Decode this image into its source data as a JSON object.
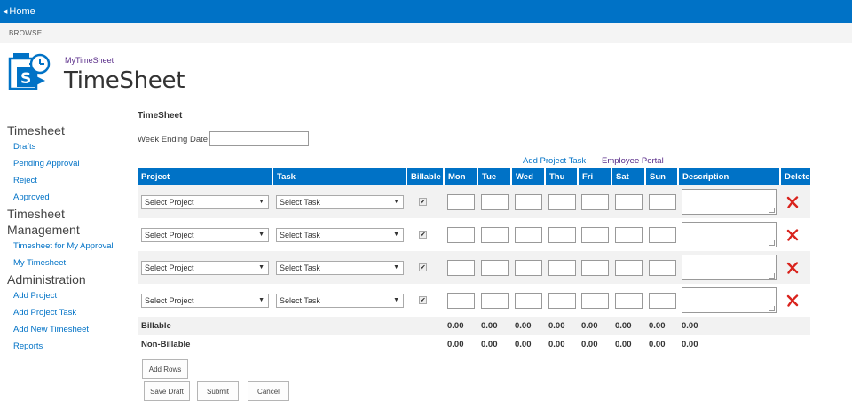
{
  "topbar": {
    "home_label": "Home"
  },
  "browse": {
    "label": "BROWSE"
  },
  "site": {
    "small_title": "MyTimeSheet",
    "title": "TimeSheet"
  },
  "nav": {
    "group1": {
      "heading": "Timesheet",
      "items": [
        "Drafts",
        "Pending Approval",
        "Reject",
        "Approved"
      ]
    },
    "group2": {
      "heading_line1": "Timesheet",
      "heading_line2": "Management",
      "items": [
        "Timesheet for My Approval",
        "My Timesheet"
      ]
    },
    "group3": {
      "heading": "Administration",
      "items": [
        "Add Project",
        "Add Project Task",
        "Add New Timesheet",
        "Reports"
      ]
    }
  },
  "form": {
    "section_title": "TimeSheet",
    "week_label": "Week Ending Date :",
    "week_value": "",
    "add_project_task_link": "Add Project Task",
    "employee_portal_link": "Employee Portal"
  },
  "table": {
    "headers": [
      "Project",
      "Task",
      "Billable",
      "Mon",
      "Tue",
      "Wed",
      "Thu",
      "Fri",
      "Sat",
      "Sun",
      "Description",
      "Delete"
    ],
    "rows": [
      {
        "project": "Select Project",
        "task": "Select Task",
        "billable": true
      },
      {
        "project": "Select Project",
        "task": "Select Task",
        "billable": true
      },
      {
        "project": "Select Project",
        "task": "Select Task",
        "billable": true
      },
      {
        "project": "Select Project",
        "task": "Select Task",
        "billable": true
      }
    ],
    "billable_summary": {
      "label": "Billable",
      "values": [
        "0.00",
        "0.00",
        "0.00",
        "0.00",
        "0.00",
        "0.00",
        "0.00",
        "0.00"
      ]
    },
    "nonbillable_summary": {
      "label": "Non-Billable",
      "values": [
        "0.00",
        "0.00",
        "0.00",
        "0.00",
        "0.00",
        "0.00",
        "0.00",
        "0.00"
      ]
    }
  },
  "buttons": {
    "add_rows": "Add Rows",
    "save_draft": "Save Draft",
    "submit": "Submit",
    "cancel": "Cancel"
  },
  "icons": {
    "home_chevron": "chevron-left-icon",
    "logo": "sharepoint-timesheet-logo",
    "delete": "delete-x-icon",
    "dropdown": "dropdown-arrow-icon",
    "checkmark": "checkmark-icon"
  },
  "colors": {
    "accent": "#0072c6",
    "suite_bar": "#0072c6",
    "link_visited": "#5a2e8a",
    "delete_red": "#d9231d",
    "row_alt": "#f2f2f2"
  }
}
